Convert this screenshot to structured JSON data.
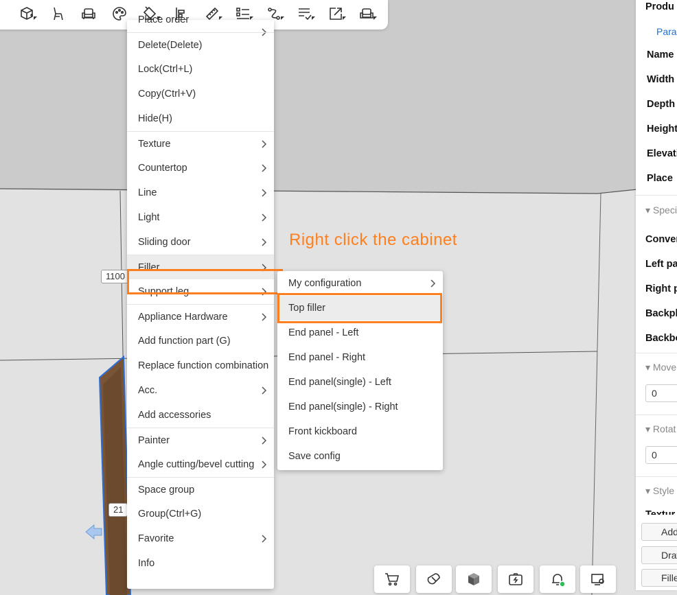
{
  "toolbar": {
    "tools": [
      "add-cabinet-icon",
      "chair-icon",
      "sofa-icon",
      "palette-icon",
      "paint-bucket-icon",
      "align-icon",
      "ruler-icon",
      "list-icon",
      "connect-icon",
      "checklist-icon",
      "export-icon",
      "sofa-outline-icon"
    ]
  },
  "context_menu": {
    "items": [
      {
        "label": "Place order",
        "submenu": true
      },
      {
        "label": "Delete(Delete)",
        "submenu": false
      },
      {
        "label": "Lock(Ctrl+L)",
        "submenu": false
      },
      {
        "label": "Copy(Ctrl+V)",
        "submenu": false
      },
      {
        "label": "Hide(H)",
        "submenu": false
      },
      {
        "label": "Texture",
        "submenu": true
      },
      {
        "label": "Countertop",
        "submenu": true
      },
      {
        "label": "Line",
        "submenu": true
      },
      {
        "label": "Light",
        "submenu": true
      },
      {
        "label": "Sliding door",
        "submenu": true
      },
      {
        "label": "Filler",
        "submenu": true
      },
      {
        "label": "Support leg",
        "submenu": true
      },
      {
        "label": "Appliance  Hardware",
        "submenu": true
      },
      {
        "label": "Add function part (G)",
        "submenu": false
      },
      {
        "label": "Replace function combination",
        "submenu": false
      },
      {
        "label": "Acc.",
        "submenu": true
      },
      {
        "label": "Add accessories",
        "submenu": false
      },
      {
        "label": "Painter",
        "submenu": true
      },
      {
        "label": "Angle cutting/bevel cutting",
        "submenu": true
      },
      {
        "label": "Space group",
        "submenu": false
      },
      {
        "label": "Group(Ctrl+G)",
        "submenu": false
      },
      {
        "label": "Favorite",
        "submenu": true
      },
      {
        "label": "Info",
        "submenu": false
      }
    ]
  },
  "filler_submenu": {
    "items": [
      {
        "label": "My configuration",
        "submenu": true
      },
      {
        "label": "Top filler",
        "submenu": false
      },
      {
        "label": "End panel - Left",
        "submenu": false
      },
      {
        "label": "End panel - Right",
        "submenu": false
      },
      {
        "label": "End panel(single) - Left",
        "submenu": false
      },
      {
        "label": "End panel(single) - Right",
        "submenu": false
      },
      {
        "label": "Front kickboard",
        "submenu": false
      },
      {
        "label": "Save config",
        "submenu": false
      }
    ]
  },
  "annotation": "Right click the cabinet",
  "dimension_labels": [
    "1100",
    "21"
  ],
  "right_panel": {
    "header": "Produ",
    "tab": "Para",
    "fields": [
      "Name",
      "Width",
      "Depth",
      "Height",
      "Elevati",
      "Place"
    ],
    "section_spec": "Speci",
    "spec_fields": [
      "Conver",
      "Left pa",
      "Right p",
      "Backpl",
      "Backbo"
    ],
    "section_move": "Move",
    "move_value": "0",
    "section_rotate": "Rotat",
    "rotate_value": "0",
    "section_style": "Style",
    "style_partial": "Textur",
    "buttons": [
      "Add",
      "Draw",
      "Filler"
    ]
  },
  "bottom_toolbar": [
    "cart-icon",
    "magnet-icon",
    "cube-icon",
    "camera-swap-icon",
    "bell-icon",
    "screen-settings-icon"
  ],
  "colors": {
    "accent": "#ff7f1e",
    "link": "#1e6fd9"
  }
}
